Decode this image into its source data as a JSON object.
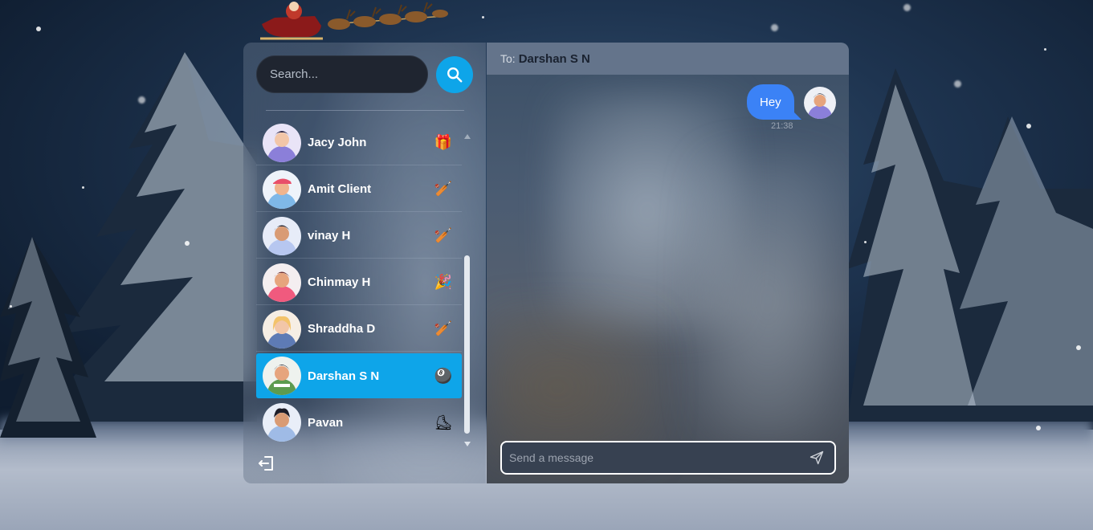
{
  "search": {
    "placeholder": "Search..."
  },
  "contacts": [
    {
      "name": "Jacy John",
      "emoji": "🎁",
      "emoji_name": "gift-icon",
      "avatar_color": "#8b7fd9"
    },
    {
      "name": "Amit Client",
      "emoji": "🏏",
      "emoji_name": "cricket-bat-icon",
      "avatar_color": "#7fb8e8"
    },
    {
      "name": "vinay H",
      "emoji": "🏏",
      "emoji_name": "cricket-bat-icon",
      "avatar_color": "#b7c7f0"
    },
    {
      "name": "Chinmay H",
      "emoji": "🎉",
      "emoji_name": "party-popper-icon",
      "avatar_color": "#f05a7e"
    },
    {
      "name": "Shraddha D",
      "emoji": "🏏",
      "emoji_name": "cricket-bat-icon",
      "avatar_color": "#f3c36b"
    },
    {
      "name": "Darshan S N",
      "emoji": "🎱",
      "emoji_name": "billiard-ball-icon",
      "avatar_color": "#5d9b4f",
      "active": true
    },
    {
      "name": "Pavan",
      "emoji": "⛸",
      "emoji_name": "ice-skate-icon",
      "avatar_color": "#9fbbe6"
    }
  ],
  "chat": {
    "to_label": "To:",
    "to_name": "Darshan S N",
    "messages": [
      {
        "text": "Hey",
        "time": "21:38",
        "from_me": true
      }
    ],
    "input_placeholder": "Send a message"
  },
  "colors": {
    "accent": "#0ea5e9",
    "bubble": "#3b82f6",
    "header": "#64748b"
  }
}
